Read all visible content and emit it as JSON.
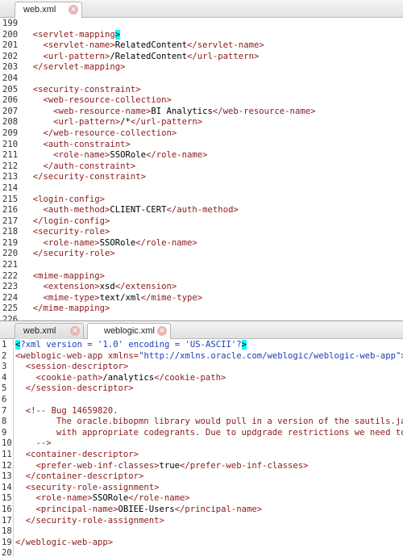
{
  "editor1": {
    "tab": {
      "label": "web.xml"
    },
    "lines": [
      {
        "n": "199",
        "indent": 0,
        "segs": []
      },
      {
        "n": "200",
        "indent": 2,
        "segs": [
          [
            "tg",
            "<servlet-mapping"
          ],
          [
            "hl",
            ">"
          ]
        ]
      },
      {
        "n": "201",
        "indent": 4,
        "segs": [
          [
            "tg",
            "<servlet-name>"
          ],
          [
            "tx",
            "RelatedContent"
          ],
          [
            "tg",
            "</servlet-name>"
          ]
        ]
      },
      {
        "n": "202",
        "indent": 4,
        "segs": [
          [
            "tg",
            "<url-pattern>"
          ],
          [
            "tx",
            "/RelatedContent"
          ],
          [
            "tg",
            "</url-pattern>"
          ]
        ]
      },
      {
        "n": "203",
        "indent": 2,
        "segs": [
          [
            "tg",
            "</servlet-mapping>"
          ]
        ]
      },
      {
        "n": "204",
        "indent": 0,
        "segs": []
      },
      {
        "n": "205",
        "indent": 2,
        "segs": [
          [
            "tg",
            "<security-constraint>"
          ]
        ]
      },
      {
        "n": "206",
        "indent": 4,
        "segs": [
          [
            "tg",
            "<web-resource-collection>"
          ]
        ]
      },
      {
        "n": "207",
        "indent": 6,
        "segs": [
          [
            "tg",
            "<web-resource-name>"
          ],
          [
            "tx",
            "BI Analytics"
          ],
          [
            "tg",
            "</web-resource-name>"
          ]
        ]
      },
      {
        "n": "208",
        "indent": 6,
        "segs": [
          [
            "tg",
            "<url-pattern>"
          ],
          [
            "tx",
            "/*"
          ],
          [
            "tg",
            "</url-pattern>"
          ]
        ]
      },
      {
        "n": "209",
        "indent": 4,
        "segs": [
          [
            "tg",
            "</web-resource-collection>"
          ]
        ]
      },
      {
        "n": "210",
        "indent": 4,
        "segs": [
          [
            "tg",
            "<auth-constraint>"
          ]
        ]
      },
      {
        "n": "211",
        "indent": 6,
        "segs": [
          [
            "tg",
            "<role-name>"
          ],
          [
            "tx",
            "SSORole"
          ],
          [
            "tg",
            "</role-name>"
          ]
        ]
      },
      {
        "n": "212",
        "indent": 4,
        "segs": [
          [
            "tg",
            "</auth-constraint>"
          ]
        ]
      },
      {
        "n": "213",
        "indent": 2,
        "segs": [
          [
            "tg",
            "</security-constraint>"
          ]
        ]
      },
      {
        "n": "214",
        "indent": 0,
        "segs": []
      },
      {
        "n": "215",
        "indent": 2,
        "segs": [
          [
            "tg",
            "<login-config>"
          ]
        ]
      },
      {
        "n": "216",
        "indent": 4,
        "segs": [
          [
            "tg",
            "<auth-method>"
          ],
          [
            "tx",
            "CLIENT-CERT"
          ],
          [
            "tg",
            "</auth-method>"
          ]
        ]
      },
      {
        "n": "217",
        "indent": 2,
        "segs": [
          [
            "tg",
            "</login-config>"
          ]
        ]
      },
      {
        "n": "218",
        "indent": 2,
        "segs": [
          [
            "tg",
            "<security-role>"
          ]
        ]
      },
      {
        "n": "219",
        "indent": 4,
        "segs": [
          [
            "tg",
            "<role-name>"
          ],
          [
            "tx",
            "SSORole"
          ],
          [
            "tg",
            "</role-name>"
          ]
        ]
      },
      {
        "n": "220",
        "indent": 2,
        "segs": [
          [
            "tg",
            "</security-role>"
          ]
        ]
      },
      {
        "n": "221",
        "indent": 0,
        "segs": []
      },
      {
        "n": "222",
        "indent": 2,
        "segs": [
          [
            "tg",
            "<mime-mapping>"
          ]
        ]
      },
      {
        "n": "223",
        "indent": 4,
        "segs": [
          [
            "tg",
            "<extension>"
          ],
          [
            "tx",
            "xsd"
          ],
          [
            "tg",
            "</extension>"
          ]
        ]
      },
      {
        "n": "224",
        "indent": 4,
        "segs": [
          [
            "tg",
            "<mime-type>"
          ],
          [
            "tx",
            "text/xml"
          ],
          [
            "tg",
            "</mime-type>"
          ]
        ]
      },
      {
        "n": "225",
        "indent": 2,
        "segs": [
          [
            "tg",
            "</mime-mapping>"
          ]
        ]
      },
      {
        "n": "226",
        "indent": 0,
        "segs": []
      }
    ]
  },
  "editor2": {
    "tabs": [
      {
        "label": "web.xml"
      },
      {
        "label": "weblogic.xml"
      }
    ],
    "lines": [
      {
        "n": "1",
        "indent": 0,
        "segs": [
          [
            "hl",
            "<"
          ],
          [
            "pi",
            "?xml version = '1.0' encoding = 'US-ASCII'?"
          ],
          [
            "hl",
            ">"
          ]
        ]
      },
      {
        "n": "2",
        "indent": 0,
        "segs": [
          [
            "tg",
            "<weblogic-web-app "
          ],
          [
            "an",
            "xmlns="
          ],
          [
            "av",
            "\"http://xmlns.oracle.com/weblogic/weblogic-web-app\""
          ],
          [
            "tg",
            ">"
          ]
        ]
      },
      {
        "n": "3",
        "indent": 2,
        "segs": [
          [
            "tg",
            "<session-descriptor>"
          ]
        ]
      },
      {
        "n": "4",
        "indent": 4,
        "segs": [
          [
            "tg",
            "<cookie-path>"
          ],
          [
            "tx",
            "/analytics"
          ],
          [
            "tg",
            "</cookie-path>"
          ]
        ]
      },
      {
        "n": "5",
        "indent": 2,
        "segs": [
          [
            "tg",
            "</session-descriptor>"
          ]
        ]
      },
      {
        "n": "6",
        "indent": 0,
        "segs": []
      },
      {
        "n": "7",
        "indent": 2,
        "segs": [
          [
            "cm",
            "<!-- Bug 14659820."
          ]
        ]
      },
      {
        "n": "8",
        "indent": 8,
        "segs": [
          [
            "cm",
            "The oracle.bibopmn library would pull in a version of the sautils.jar"
          ]
        ]
      },
      {
        "n": "9",
        "indent": 8,
        "segs": [
          [
            "cm",
            "with appropriate codegrants. Due to updgrade restrictions we need to"
          ]
        ]
      },
      {
        "n": "10",
        "indent": 4,
        "segs": [
          [
            "cm",
            "-->"
          ]
        ]
      },
      {
        "n": "11",
        "indent": 2,
        "segs": [
          [
            "tg",
            "<container-descriptor>"
          ]
        ]
      },
      {
        "n": "12",
        "indent": 4,
        "segs": [
          [
            "tg",
            "<prefer-web-inf-classes>"
          ],
          [
            "tx",
            "true"
          ],
          [
            "tg",
            "</prefer-web-inf-classes>"
          ]
        ]
      },
      {
        "n": "13",
        "indent": 2,
        "segs": [
          [
            "tg",
            "</container-descriptor>"
          ]
        ]
      },
      {
        "n": "14",
        "indent": 2,
        "segs": [
          [
            "tg",
            "<security-role-assignment>"
          ]
        ]
      },
      {
        "n": "15",
        "indent": 4,
        "segs": [
          [
            "tg",
            "<role-name>"
          ],
          [
            "tx",
            "SSORole"
          ],
          [
            "tg",
            "</role-name>"
          ]
        ]
      },
      {
        "n": "16",
        "indent": 4,
        "segs": [
          [
            "tg",
            "<principal-name>"
          ],
          [
            "tx",
            "OBIEE-Users"
          ],
          [
            "tg",
            "</principal-name>"
          ]
        ]
      },
      {
        "n": "17",
        "indent": 2,
        "segs": [
          [
            "tg",
            "</security-role-assignment>"
          ]
        ]
      },
      {
        "n": "18",
        "indent": 0,
        "segs": []
      },
      {
        "n": "19",
        "indent": 0,
        "segs": [
          [
            "tg",
            "</weblogic-web-app>"
          ]
        ]
      },
      {
        "n": "20",
        "indent": 0,
        "segs": []
      }
    ]
  }
}
